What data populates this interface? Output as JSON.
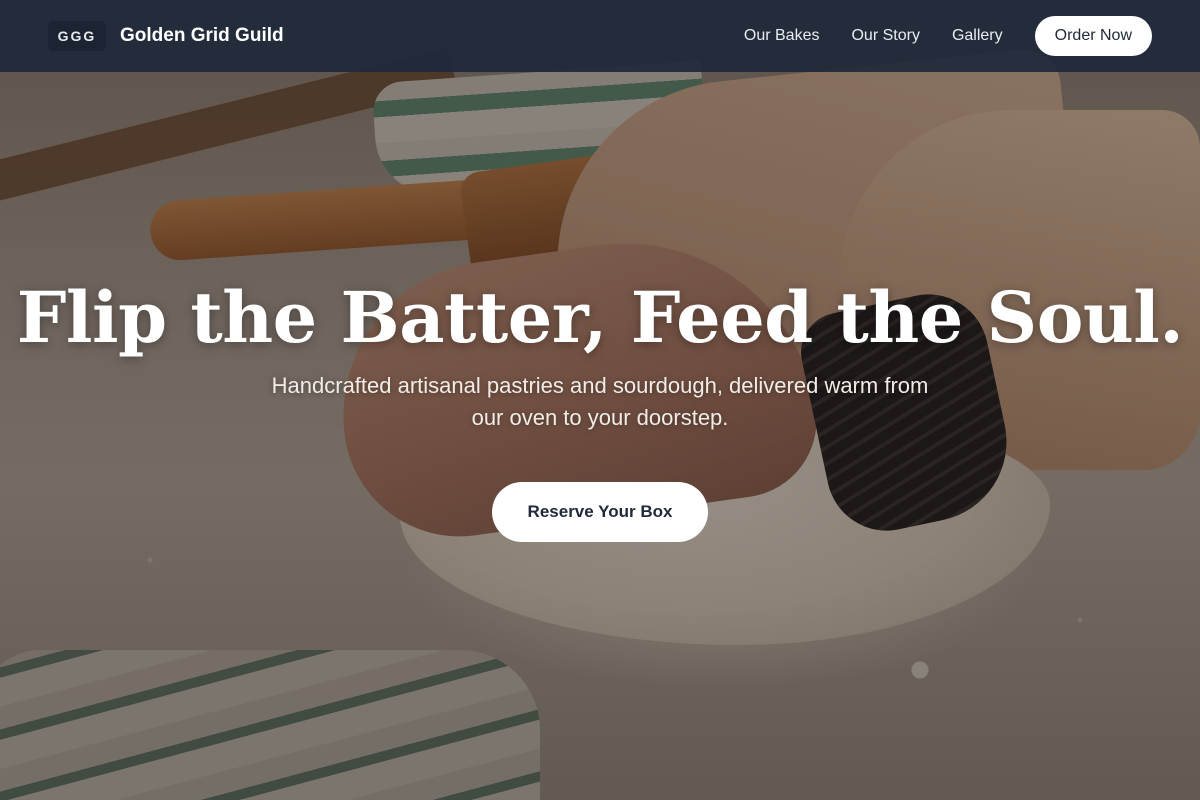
{
  "nav": {
    "logo_text": "GGG",
    "brand_name": "Golden Grid Guild",
    "links": [
      "Our Bakes",
      "Our Story",
      "Gallery"
    ],
    "cta_label": "Order Now"
  },
  "hero": {
    "title": "Flip the Batter, Feed the Soul.",
    "subtitle": "Handcrafted artisanal pastries and sourdough, delivered warm from our oven to your doorstep.",
    "cta_label": "Reserve Your Box"
  },
  "colors": {
    "nav_background": "#1f293a",
    "button_background": "#ffffff",
    "button_text": "#1f2937",
    "heading_text": "#ffffff"
  }
}
